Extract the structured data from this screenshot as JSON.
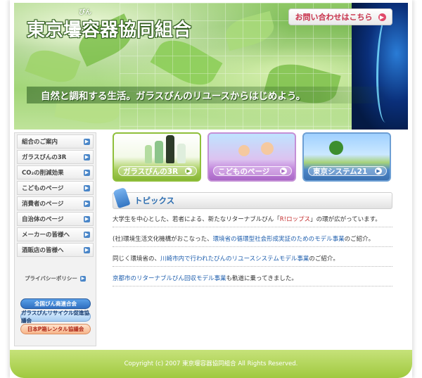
{
  "header": {
    "title": "東京壜容器協同組合",
    "title_ruby": "びん",
    "contact_label": "お問い合わせはこちら",
    "tagline": "自然と調和する生活。ガラスびんのリユースからはじめよう。"
  },
  "sidebar": {
    "items": [
      {
        "label": "組合のご案内"
      },
      {
        "label": "ガラスびんの3R"
      },
      {
        "label": "CO₂の削減効果"
      },
      {
        "label": "こどものページ"
      },
      {
        "label": "消費者のページ"
      },
      {
        "label": "自治体のページ"
      },
      {
        "label": "メーカーの皆様へ"
      },
      {
        "label": "酒販店の皆様へ"
      }
    ],
    "privacy": "プライバシーポリシー",
    "partners": [
      "全国びん商連合会",
      "ガラスびんリサイクル促進協議会",
      "日本P箱レンタル協議会"
    ]
  },
  "banners": [
    {
      "label": "ガラスびんの3R"
    },
    {
      "label": "こどものページ"
    },
    {
      "label": "東京システム21"
    }
  ],
  "topics": {
    "title": "トピックス",
    "items": [
      {
        "pre": "大学生を中心とした、若者による、新たなリターナブルびん「",
        "link": "R!ロップス",
        "post": "」の環が広がっています。"
      },
      {
        "pre": "(社)環境生活文化機構がおこなった、",
        "link": "環境省の循環型社会形成実証のためのモデル事業",
        "post": "のご紹介。"
      },
      {
        "pre": "同じく環境省の、",
        "link": "川崎市内で行われたびんのリユースシステムモデル事業",
        "post": "のご紹介。"
      },
      {
        "pre": "",
        "link": "京都市のリターナブルびん回収モデル事業",
        "post": "も軌道に乗ってきました。"
      }
    ]
  },
  "footer": {
    "copyright": "Copyright (c) 2007 東京壜容器協同組合 All Rights Reserved."
  }
}
